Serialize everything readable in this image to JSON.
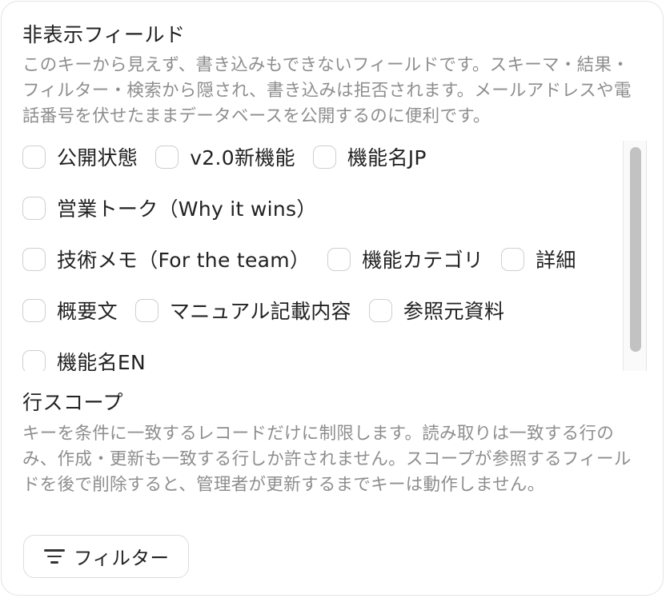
{
  "hidden_fields": {
    "title": "非表示フィールド",
    "description": "このキーから見えず、書き込みもできないフィールドです。スキーマ・結果・フィルター・検索から隠され、書き込みは拒否されます。メールアドレスや電話番号を伏せたままデータベースを公開するのに便利です。",
    "rows": [
      [
        {
          "label": "公開状態",
          "checked": false
        },
        {
          "label": "v2.0新機能",
          "checked": false
        },
        {
          "label": "機能名JP",
          "checked": false
        }
      ],
      [
        {
          "label": "営業トーク（Why it wins）",
          "checked": false
        }
      ],
      [
        {
          "label": "技術メモ（For the team）",
          "checked": false
        },
        {
          "label": "機能カテゴリ",
          "checked": false
        },
        {
          "label": "詳細",
          "checked": false
        }
      ],
      [
        {
          "label": "概要文",
          "checked": false
        },
        {
          "label": "マニュアル記載内容",
          "checked": false
        },
        {
          "label": "参照元資料",
          "checked": false
        }
      ],
      [
        {
          "label": "機能名EN",
          "checked": false
        }
      ]
    ]
  },
  "row_scope": {
    "title": "行スコープ",
    "description": "キーを条件に一致するレコードだけに制限します。読み取りは一致する行のみ、作成・更新も一致する行しか許されません。スコープが参照するフィールドを後で削除すると、管理者が更新するまでキーは動作しません。",
    "filter_button_label": "フィルター",
    "filter_icon": "filter-lines-icon"
  }
}
